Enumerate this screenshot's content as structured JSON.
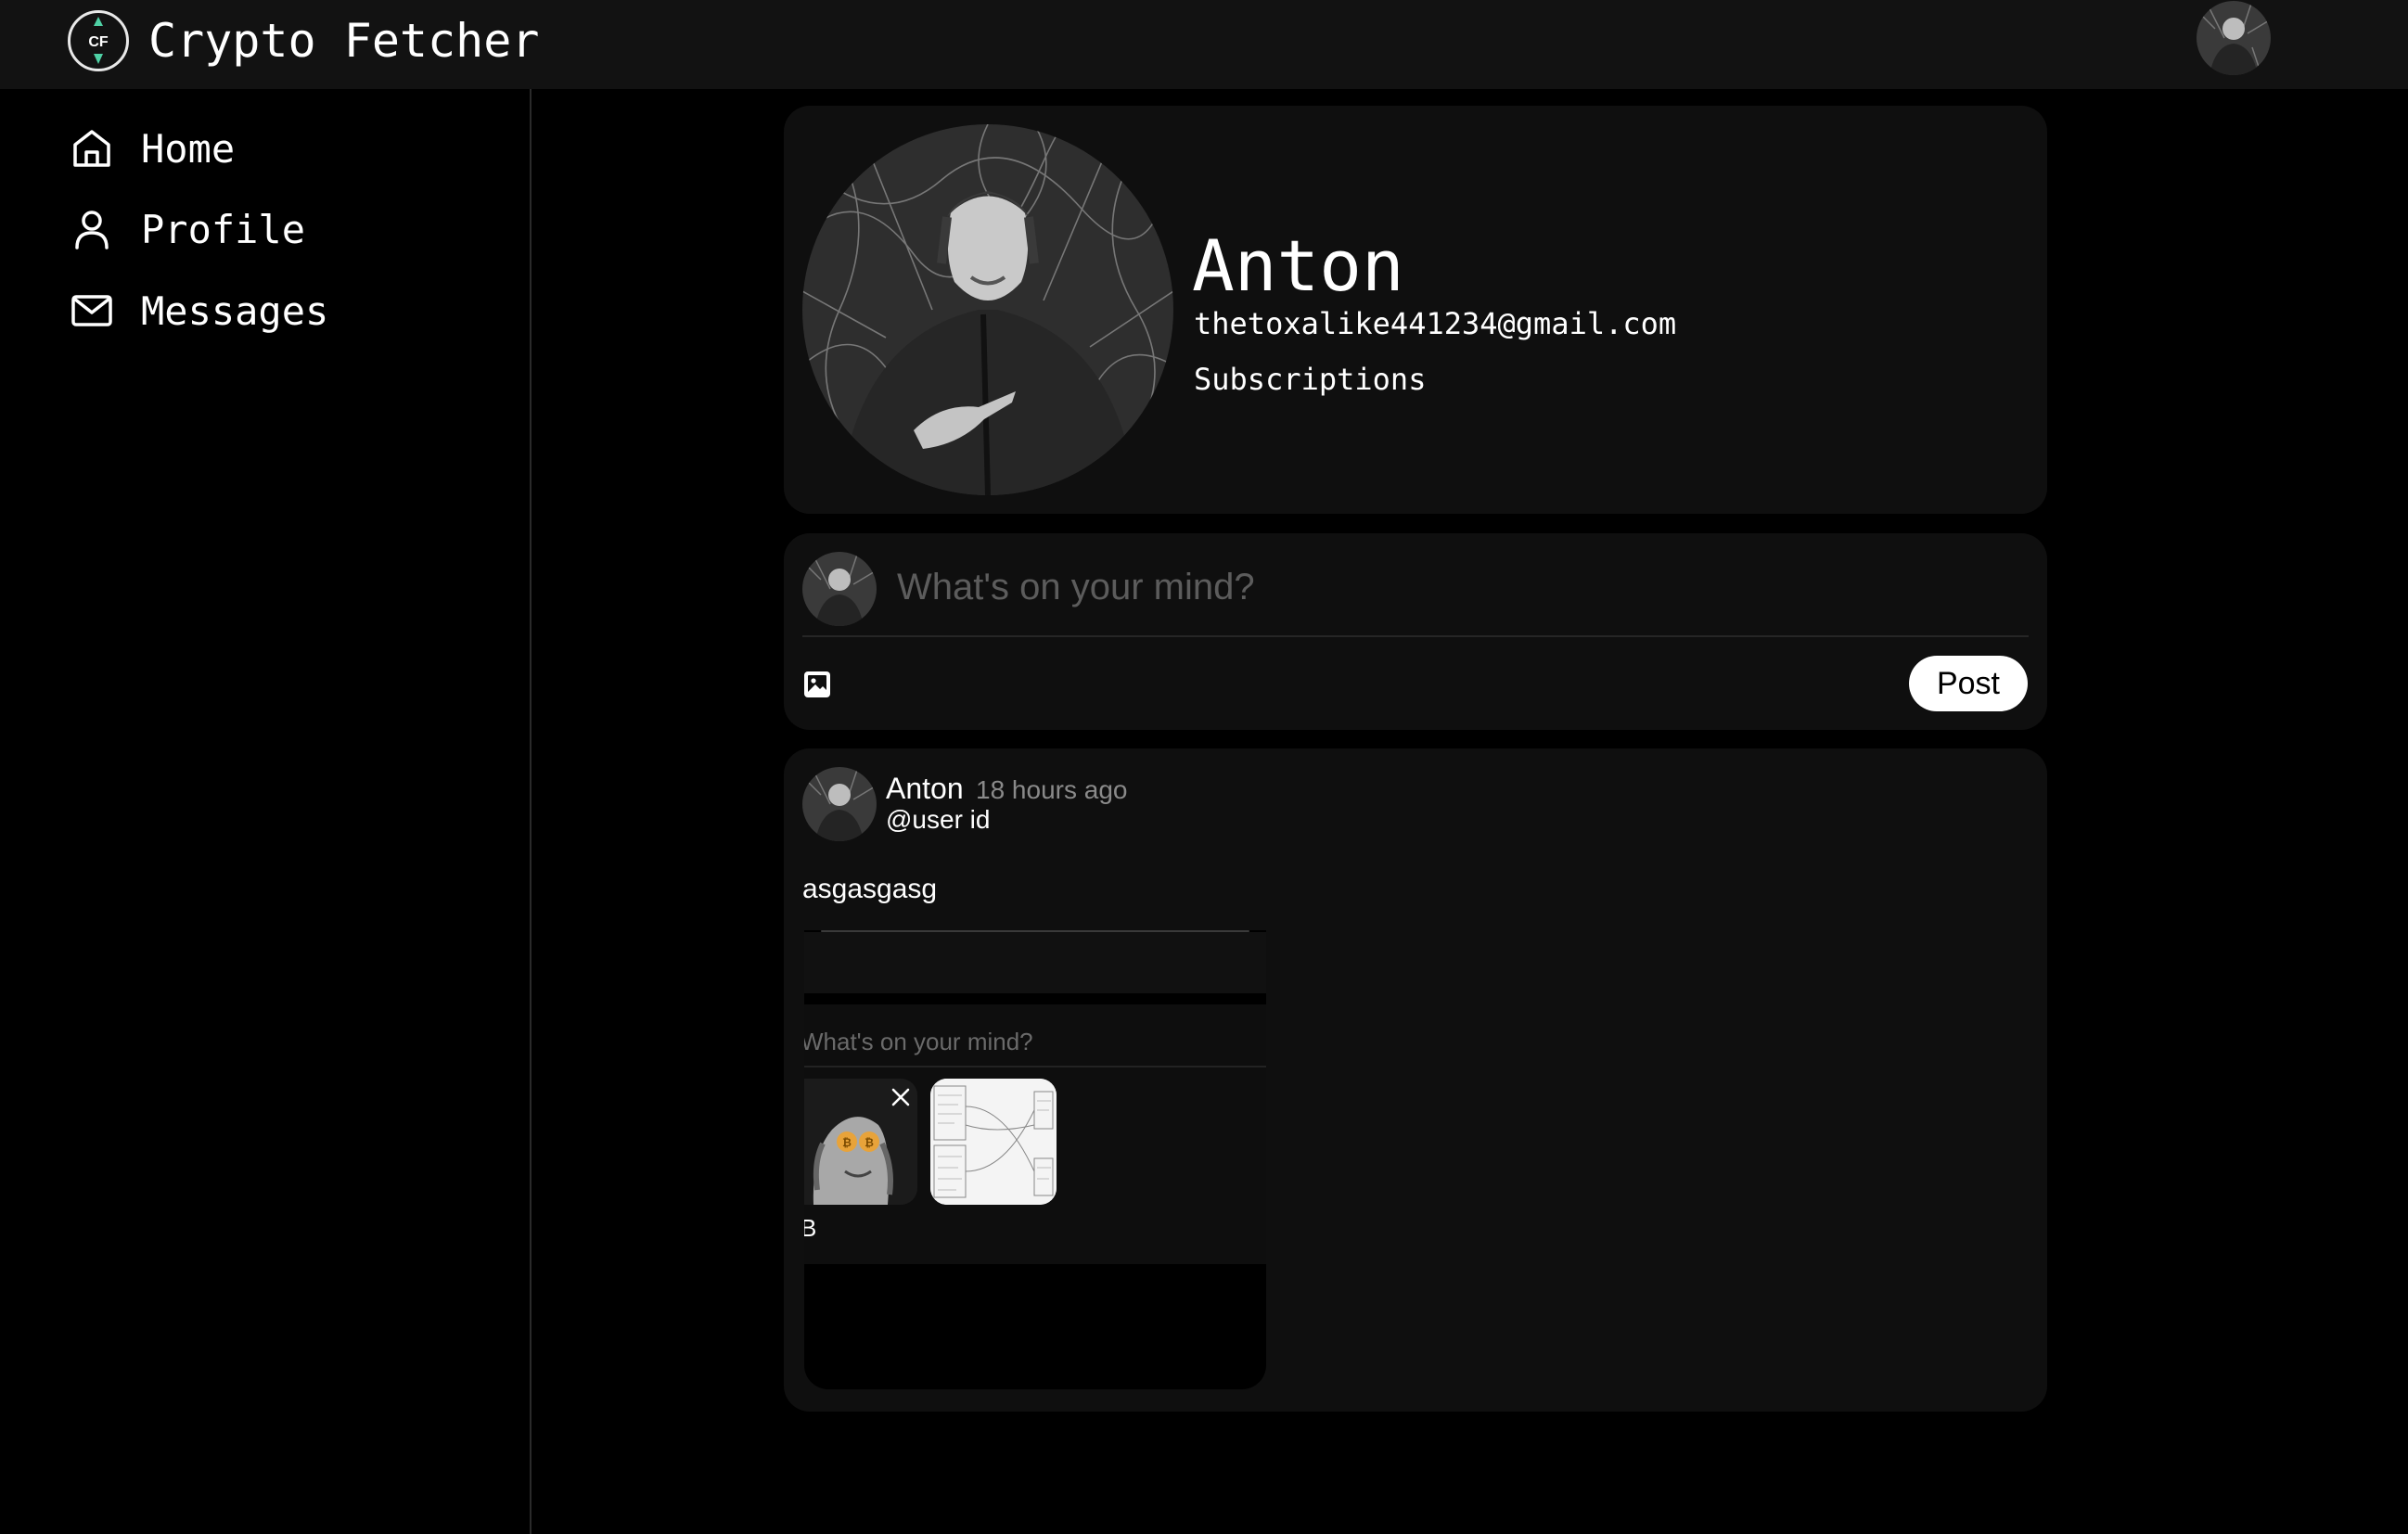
{
  "app": {
    "title": "Crypto Fetcher",
    "logo_text": "CF",
    "accent_color": "#4fd1a5"
  },
  "header": {
    "avatar_icon": "user-avatar"
  },
  "sidebar": {
    "items": [
      {
        "label": "Home",
        "icon": "home-icon"
      },
      {
        "label": "Profile",
        "icon": "user-icon"
      },
      {
        "label": "Messages",
        "icon": "mail-icon"
      }
    ]
  },
  "profile": {
    "name": "Anton",
    "email": "thetoxalike441234@gmail.com",
    "subscriptions_label": "Subscriptions"
  },
  "composer": {
    "placeholder": "What's on your mind?",
    "post_label": "Post",
    "image_icon": "image-icon"
  },
  "post": {
    "author": "Anton",
    "time": "18 hours ago",
    "handle": "@user id",
    "text": "asgasgasg",
    "attachment": {
      "placeholder": "What's on your mind?",
      "partial_char": "B"
    }
  }
}
